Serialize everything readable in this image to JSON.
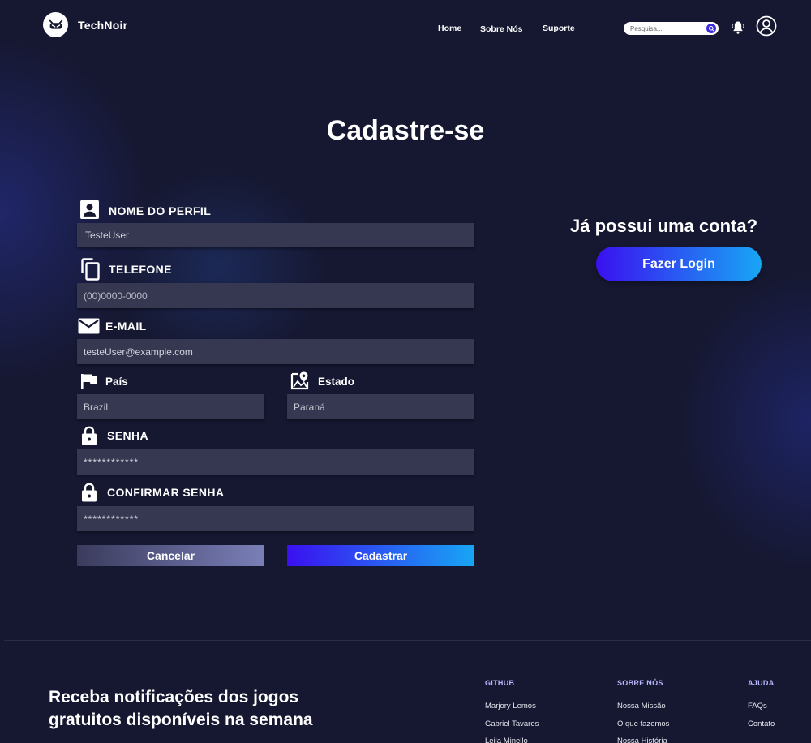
{
  "brand": {
    "name": "TechNoir"
  },
  "nav": {
    "items": [
      "Home",
      "Sobre Nós",
      "Suporte"
    ]
  },
  "search": {
    "placeholder": "Pesquisa..."
  },
  "page": {
    "title": "Cadastre-se"
  },
  "form": {
    "profile_name": {
      "label": "NOME DO PERFIL",
      "value": "TesteUser"
    },
    "phone": {
      "label": "TELEFONE",
      "placeholder": "(00)0000-0000"
    },
    "email": {
      "label": "E-MAIL",
      "value": "testeUser@example.com"
    },
    "country": {
      "label": "País",
      "value": "Brazil"
    },
    "state": {
      "label": "Estado",
      "value": "Paraná"
    },
    "password": {
      "label": "SENHA",
      "value": "************"
    },
    "confirm_password": {
      "label": "CONFIRMAR SENHA",
      "value": "************"
    },
    "cancel_label": "Cancelar",
    "submit_label": "Cadastrar"
  },
  "login": {
    "question": "Já possui uma conta?",
    "button_label": "Fazer Login"
  },
  "footer": {
    "newsletter_line1": "Receba notificações dos jogos",
    "newsletter_line2": "gratuitos disponíveis na semana",
    "columns": [
      {
        "title": "GITHUB",
        "links": [
          "Marjory Lemos",
          "Gabriel Tavares",
          "Leila Minello"
        ]
      },
      {
        "title": "SOBRE NÓS",
        "links": [
          "Nossa Missão",
          "O que fazemos",
          "Nossa História"
        ]
      },
      {
        "title": "AJUDA",
        "links": [
          "FAQs",
          "Contato"
        ]
      }
    ]
  },
  "colors": {
    "background": "#161832",
    "field": "#363852",
    "accent_start": "#3a10f0",
    "accent_end": "#18a6f4",
    "footer_heading": "#b9b7ff"
  },
  "icons": [
    "logo-mark-icon",
    "search-icon",
    "bell-icon",
    "user-circle-icon",
    "profile-card-icon",
    "phone-copy-icon",
    "mail-icon",
    "flag-icon",
    "map-pin-icon",
    "lock-icon"
  ]
}
